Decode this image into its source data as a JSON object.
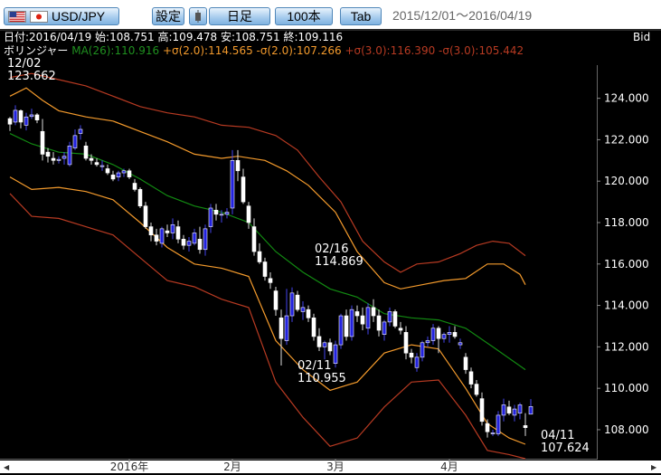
{
  "toolbar": {
    "pair": "USD/JPY",
    "settings": "設定",
    "timeframe": "日足",
    "count": "100本",
    "tab": "Tab",
    "date_range": "2015/12/01～2016/04/19"
  },
  "ohlc_line": "日付:2016/04/19 始:108.751 高:109.478 安:108.751 終:109.116",
  "price_side": "Bid",
  "indicator": {
    "prefix": "ボリンジャー",
    "ma": "MA(26):110.916",
    "sigma2_up": "+σ(2.0):114.565",
    "sigma2_dn": "-σ(2.0):107.266",
    "sigma3_up": "+σ(3.0):116.390",
    "sigma3_dn": "-σ(3.0):105.442"
  },
  "colors": {
    "background": "#000000",
    "candle_up": "#2222dd",
    "candle_down": "#ffffff",
    "ma": "#128a12",
    "sigma2": "#f39a2c",
    "sigma3": "#b73a22",
    "text": "#ffffff"
  },
  "chart_data": {
    "type": "candlestick",
    "x_labels": [
      {
        "i": 22,
        "label": "2016年"
      },
      {
        "i": 41,
        "label": "2月"
      },
      {
        "i": 60,
        "label": "3月"
      },
      {
        "i": 81,
        "label": "4月"
      }
    ],
    "ylim": [
      106.6,
      125.6
    ],
    "y_ticks": [
      "124.000",
      "122.000",
      "120.000",
      "118.000",
      "116.000",
      "114.000",
      "112.000",
      "110.000",
      "108.000"
    ],
    "annotations": [
      {
        "date": "12/02",
        "value": "123.662",
        "i": 1
      },
      {
        "date": "02/16",
        "value": "114.869",
        "i": 51
      },
      {
        "date": "02/11",
        "value": "110.955",
        "i": 48
      },
      {
        "date": "04/11",
        "value": "107.624",
        "i": 87
      }
    ],
    "candles": [
      [
        123.02,
        123.1,
        122.42,
        122.75
      ],
      [
        122.85,
        123.66,
        122.7,
        123.42
      ],
      [
        123.4,
        123.46,
        122.55,
        122.85
      ],
      [
        122.7,
        123.3,
        122.45,
        123.1
      ],
      [
        123.12,
        123.5,
        123.0,
        123.2
      ],
      [
        123.2,
        123.28,
        122.8,
        122.95
      ],
      [
        122.4,
        123.0,
        121.0,
        121.3
      ],
      [
        121.4,
        121.6,
        120.9,
        121.2
      ],
      [
        121.1,
        121.4,
        120.8,
        121.0
      ],
      [
        121.0,
        121.2,
        120.85,
        121.05
      ],
      [
        121.1,
        121.4,
        120.8,
        121.2
      ],
      [
        120.8,
        121.9,
        120.7,
        121.7
      ],
      [
        121.6,
        122.5,
        121.5,
        122.2
      ],
      [
        122.3,
        122.7,
        122.0,
        122.5
      ],
      [
        121.7,
        121.9,
        121.0,
        121.1
      ],
      [
        121.1,
        121.3,
        120.8,
        121.0
      ],
      [
        120.9,
        121.1,
        120.7,
        120.8
      ],
      [
        120.7,
        121.0,
        120.5,
        120.75
      ],
      [
        120.6,
        120.8,
        120.3,
        120.4
      ],
      [
        120.3,
        120.5,
        120.0,
        120.1
      ],
      [
        120.2,
        120.5,
        120.0,
        120.4
      ],
      [
        120.4,
        120.6,
        120.2,
        120.5
      ],
      [
        120.5,
        120.6,
        120.1,
        120.2
      ],
      [
        119.9,
        120.1,
        119.5,
        119.6
      ],
      [
        119.6,
        119.7,
        118.7,
        118.8
      ],
      [
        118.8,
        119.0,
        117.7,
        117.8
      ],
      [
        117.8,
        118.0,
        117.1,
        117.4
      ],
      [
        117.4,
        117.7,
        116.9,
        117.1
      ],
      [
        117.0,
        117.8,
        116.8,
        117.7
      ],
      [
        117.6,
        117.9,
        117.3,
        117.5
      ],
      [
        117.5,
        118.2,
        117.2,
        117.9
      ],
      [
        117.8,
        118.1,
        117.0,
        117.2
      ],
      [
        117.2,
        117.4,
        116.7,
        116.9
      ],
      [
        116.9,
        117.3,
        116.6,
        117.1
      ],
      [
        117.0,
        117.7,
        116.9,
        117.5
      ],
      [
        117.2,
        117.8,
        116.5,
        116.7
      ],
      [
        116.7,
        117.9,
        116.4,
        117.7
      ],
      [
        117.8,
        118.9,
        117.5,
        118.7
      ],
      [
        118.6,
        118.9,
        118.1,
        118.4
      ],
      [
        118.4,
        118.6,
        118.0,
        118.4
      ],
      [
        118.4,
        118.7,
        118.2,
        118.5
      ],
      [
        118.7,
        121.5,
        118.4,
        121.0
      ],
      [
        121.0,
        121.5,
        120.0,
        120.5
      ],
      [
        120.2,
        120.6,
        118.9,
        119.0
      ],
      [
        118.8,
        119.0,
        117.7,
        118.0
      ],
      [
        117.8,
        118.2,
        116.4,
        116.6
      ],
      [
        116.6,
        117.0,
        116.0,
        116.1
      ],
      [
        116.1,
        116.3,
        115.2,
        115.4
      ],
      [
        115.3,
        115.6,
        114.8,
        115.1
      ],
      [
        114.7,
        114.9,
        113.5,
        113.8
      ],
      [
        113.4,
        113.8,
        111.1,
        112.4
      ],
      [
        112.3,
        114.8,
        112.1,
        113.5
      ],
      [
        113.5,
        114.87,
        113.2,
        114.6
      ],
      [
        114.5,
        114.7,
        113.7,
        113.8
      ],
      [
        113.7,
        114.2,
        113.3,
        113.9
      ],
      [
        113.8,
        114.0,
        113.2,
        113.4
      ],
      [
        113.4,
        113.6,
        112.3,
        112.5
      ],
      [
        112.5,
        112.9,
        111.8,
        112.0
      ],
      [
        112.0,
        112.3,
        111.4,
        112.2
      ],
      [
        112.2,
        112.4,
        111.6,
        111.8
      ],
      [
        111.2,
        112.3,
        111.0,
        112.1
      ],
      [
        112.1,
        113.6,
        111.9,
        113.5
      ],
      [
        113.5,
        113.8,
        112.3,
        112.5
      ],
      [
        112.5,
        114.0,
        112.3,
        113.8
      ],
      [
        113.7,
        114.0,
        113.2,
        113.5
      ],
      [
        113.5,
        113.9,
        112.8,
        113.1
      ],
      [
        112.9,
        114.1,
        112.6,
        113.9
      ],
      [
        113.9,
        114.3,
        113.2,
        113.5
      ],
      [
        113.5,
        113.8,
        112.5,
        112.8
      ],
      [
        112.6,
        113.3,
        112.3,
        113.2
      ],
      [
        113.2,
        113.9,
        113.0,
        113.7
      ],
      [
        113.7,
        113.8,
        112.9,
        113.0
      ],
      [
        112.9,
        113.2,
        112.6,
        112.8
      ],
      [
        112.7,
        113.0,
        111.4,
        111.7
      ],
      [
        111.7,
        111.9,
        111.2,
        111.5
      ],
      [
        111.0,
        111.7,
        110.8,
        111.5
      ],
      [
        111.5,
        112.3,
        111.3,
        112.2
      ],
      [
        112.2,
        112.5,
        112.0,
        112.3
      ],
      [
        112.3,
        113.1,
        112.1,
        112.9
      ],
      [
        112.9,
        113.0,
        111.7,
        112.4
      ],
      [
        112.4,
        112.7,
        112.2,
        112.6
      ],
      [
        112.6,
        113.0,
        112.2,
        112.7
      ],
      [
        112.7,
        113.0,
        112.4,
        112.5
      ],
      [
        112.1,
        112.4,
        111.9,
        112.2
      ],
      [
        111.5,
        111.7,
        110.7,
        110.9
      ],
      [
        110.8,
        111.0,
        110.0,
        110.2
      ],
      [
        110.2,
        110.4,
        109.6,
        109.7
      ],
      [
        109.5,
        109.8,
        108.2,
        108.4
      ],
      [
        108.3,
        108.5,
        107.62,
        107.9
      ],
      [
        107.8,
        108.0,
        107.7,
        107.85
      ],
      [
        107.8,
        108.9,
        107.7,
        108.7
      ],
      [
        108.7,
        109.5,
        108.4,
        109.2
      ],
      [
        109.1,
        109.4,
        108.7,
        108.8
      ],
      [
        108.7,
        109.2,
        108.4,
        109.0
      ],
      [
        108.8,
        109.3,
        108.5,
        109.2
      ],
      [
        108.2,
        108.8,
        107.7,
        108.1
      ],
      [
        108.75,
        109.48,
        108.75,
        109.12
      ]
    ],
    "ma": [
      [
        0,
        122.3
      ],
      [
        4,
        121.8
      ],
      [
        9,
        121.4
      ],
      [
        14,
        121.3
      ],
      [
        19,
        120.8
      ],
      [
        24,
        120.1
      ],
      [
        29,
        119.3
      ],
      [
        34,
        118.8
      ],
      [
        39,
        118.5
      ],
      [
        44,
        118.0
      ],
      [
        49,
        116.6
      ],
      [
        54,
        115.6
      ],
      [
        59,
        114.8
      ],
      [
        64,
        114.4
      ],
      [
        69,
        113.6
      ],
      [
        74,
        113.4
      ],
      [
        79,
        113.3
      ],
      [
        84,
        112.9
      ],
      [
        89,
        112.0
      ],
      [
        95,
        110.9
      ]
    ],
    "sigma2_upper": [
      [
        0,
        124.1
      ],
      [
        3,
        124.5
      ],
      [
        6,
        123.9
      ],
      [
        9,
        123.4
      ],
      [
        14,
        123.1
      ],
      [
        19,
        122.9
      ],
      [
        24,
        122.4
      ],
      [
        29,
        121.9
      ],
      [
        34,
        121.3
      ],
      [
        39,
        121.1
      ],
      [
        42,
        121.2
      ],
      [
        47,
        121.0
      ],
      [
        51,
        120.5
      ],
      [
        55,
        119.8
      ],
      [
        60,
        118.5
      ],
      [
        64,
        116.6
      ],
      [
        69,
        115.1
      ],
      [
        72,
        114.8
      ],
      [
        76,
        115.0
      ],
      [
        80,
        115.2
      ],
      [
        84,
        115.3
      ],
      [
        88,
        116.0
      ],
      [
        91,
        116.0
      ],
      [
        94,
        115.5
      ],
      [
        95,
        115.0
      ]
    ],
    "sigma2_lower": [
      [
        0,
        120.2
      ],
      [
        4,
        119.6
      ],
      [
        9,
        119.7
      ],
      [
        14,
        119.5
      ],
      [
        19,
        119.1
      ],
      [
        24,
        118.0
      ],
      [
        29,
        116.8
      ],
      [
        34,
        116.0
      ],
      [
        39,
        115.8
      ],
      [
        44,
        115.4
      ],
      [
        49,
        112.3
      ],
      [
        54,
        110.9
      ],
      [
        59,
        109.9
      ],
      [
        64,
        110.3
      ],
      [
        69,
        111.7
      ],
      [
        74,
        112.1
      ],
      [
        79,
        111.9
      ],
      [
        84,
        110.0
      ],
      [
        88,
        108.3
      ],
      [
        92,
        107.6
      ],
      [
        95,
        107.3
      ]
    ],
    "sigma3_upper": [
      [
        0,
        125.0
      ],
      [
        4,
        125.2
      ],
      [
        9,
        124.9
      ],
      [
        14,
        124.6
      ],
      [
        19,
        124.1
      ],
      [
        24,
        123.6
      ],
      [
        29,
        123.3
      ],
      [
        34,
        123.1
      ],
      [
        39,
        122.7
      ],
      [
        44,
        122.6
      ],
      [
        49,
        122.2
      ],
      [
        53,
        121.5
      ],
      [
        57,
        120.2
      ],
      [
        61,
        119.0
      ],
      [
        65,
        117.1
      ],
      [
        69,
        116.1
      ],
      [
        72,
        115.6
      ],
      [
        75,
        116.0
      ],
      [
        79,
        116.1
      ],
      [
        83,
        116.5
      ],
      [
        86,
        116.9
      ],
      [
        89,
        117.1
      ],
      [
        92,
        117.0
      ],
      [
        95,
        116.4
      ]
    ],
    "sigma3_lower": [
      [
        0,
        119.4
      ],
      [
        4,
        118.3
      ],
      [
        9,
        118.2
      ],
      [
        14,
        117.8
      ],
      [
        19,
        117.4
      ],
      [
        24,
        116.3
      ],
      [
        29,
        115.2
      ],
      [
        34,
        114.9
      ],
      [
        39,
        114.3
      ],
      [
        44,
        113.9
      ],
      [
        49,
        110.3
      ],
      [
        54,
        108.6
      ],
      [
        59,
        107.2
      ],
      [
        64,
        107.6
      ],
      [
        69,
        109.1
      ],
      [
        74,
        110.3
      ],
      [
        79,
        110.4
      ],
      [
        84,
        108.7
      ],
      [
        88,
        107.0
      ],
      [
        92,
        106.8
      ],
      [
        95,
        106.6
      ]
    ]
  }
}
